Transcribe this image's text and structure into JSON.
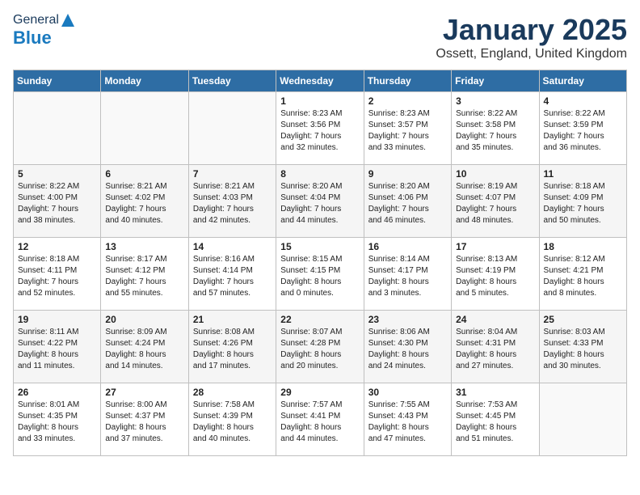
{
  "header": {
    "logo": {
      "general": "General",
      "blue": "Blue"
    },
    "title": "January 2025",
    "location": "Ossett, England, United Kingdom"
  },
  "weekdays": [
    "Sunday",
    "Monday",
    "Tuesday",
    "Wednesday",
    "Thursday",
    "Friday",
    "Saturday"
  ],
  "weeks": [
    [
      {
        "day": "",
        "text": ""
      },
      {
        "day": "",
        "text": ""
      },
      {
        "day": "",
        "text": ""
      },
      {
        "day": "1",
        "text": "Sunrise: 8:23 AM\nSunset: 3:56 PM\nDaylight: 7 hours\nand 32 minutes."
      },
      {
        "day": "2",
        "text": "Sunrise: 8:23 AM\nSunset: 3:57 PM\nDaylight: 7 hours\nand 33 minutes."
      },
      {
        "day": "3",
        "text": "Sunrise: 8:22 AM\nSunset: 3:58 PM\nDaylight: 7 hours\nand 35 minutes."
      },
      {
        "day": "4",
        "text": "Sunrise: 8:22 AM\nSunset: 3:59 PM\nDaylight: 7 hours\nand 36 minutes."
      }
    ],
    [
      {
        "day": "5",
        "text": "Sunrise: 8:22 AM\nSunset: 4:00 PM\nDaylight: 7 hours\nand 38 minutes."
      },
      {
        "day": "6",
        "text": "Sunrise: 8:21 AM\nSunset: 4:02 PM\nDaylight: 7 hours\nand 40 minutes."
      },
      {
        "day": "7",
        "text": "Sunrise: 8:21 AM\nSunset: 4:03 PM\nDaylight: 7 hours\nand 42 minutes."
      },
      {
        "day": "8",
        "text": "Sunrise: 8:20 AM\nSunset: 4:04 PM\nDaylight: 7 hours\nand 44 minutes."
      },
      {
        "day": "9",
        "text": "Sunrise: 8:20 AM\nSunset: 4:06 PM\nDaylight: 7 hours\nand 46 minutes."
      },
      {
        "day": "10",
        "text": "Sunrise: 8:19 AM\nSunset: 4:07 PM\nDaylight: 7 hours\nand 48 minutes."
      },
      {
        "day": "11",
        "text": "Sunrise: 8:18 AM\nSunset: 4:09 PM\nDaylight: 7 hours\nand 50 minutes."
      }
    ],
    [
      {
        "day": "12",
        "text": "Sunrise: 8:18 AM\nSunset: 4:11 PM\nDaylight: 7 hours\nand 52 minutes."
      },
      {
        "day": "13",
        "text": "Sunrise: 8:17 AM\nSunset: 4:12 PM\nDaylight: 7 hours\nand 55 minutes."
      },
      {
        "day": "14",
        "text": "Sunrise: 8:16 AM\nSunset: 4:14 PM\nDaylight: 7 hours\nand 57 minutes."
      },
      {
        "day": "15",
        "text": "Sunrise: 8:15 AM\nSunset: 4:15 PM\nDaylight: 8 hours\nand 0 minutes."
      },
      {
        "day": "16",
        "text": "Sunrise: 8:14 AM\nSunset: 4:17 PM\nDaylight: 8 hours\nand 3 minutes."
      },
      {
        "day": "17",
        "text": "Sunrise: 8:13 AM\nSunset: 4:19 PM\nDaylight: 8 hours\nand 5 minutes."
      },
      {
        "day": "18",
        "text": "Sunrise: 8:12 AM\nSunset: 4:21 PM\nDaylight: 8 hours\nand 8 minutes."
      }
    ],
    [
      {
        "day": "19",
        "text": "Sunrise: 8:11 AM\nSunset: 4:22 PM\nDaylight: 8 hours\nand 11 minutes."
      },
      {
        "day": "20",
        "text": "Sunrise: 8:09 AM\nSunset: 4:24 PM\nDaylight: 8 hours\nand 14 minutes."
      },
      {
        "day": "21",
        "text": "Sunrise: 8:08 AM\nSunset: 4:26 PM\nDaylight: 8 hours\nand 17 minutes."
      },
      {
        "day": "22",
        "text": "Sunrise: 8:07 AM\nSunset: 4:28 PM\nDaylight: 8 hours\nand 20 minutes."
      },
      {
        "day": "23",
        "text": "Sunrise: 8:06 AM\nSunset: 4:30 PM\nDaylight: 8 hours\nand 24 minutes."
      },
      {
        "day": "24",
        "text": "Sunrise: 8:04 AM\nSunset: 4:31 PM\nDaylight: 8 hours\nand 27 minutes."
      },
      {
        "day": "25",
        "text": "Sunrise: 8:03 AM\nSunset: 4:33 PM\nDaylight: 8 hours\nand 30 minutes."
      }
    ],
    [
      {
        "day": "26",
        "text": "Sunrise: 8:01 AM\nSunset: 4:35 PM\nDaylight: 8 hours\nand 33 minutes."
      },
      {
        "day": "27",
        "text": "Sunrise: 8:00 AM\nSunset: 4:37 PM\nDaylight: 8 hours\nand 37 minutes."
      },
      {
        "day": "28",
        "text": "Sunrise: 7:58 AM\nSunset: 4:39 PM\nDaylight: 8 hours\nand 40 minutes."
      },
      {
        "day": "29",
        "text": "Sunrise: 7:57 AM\nSunset: 4:41 PM\nDaylight: 8 hours\nand 44 minutes."
      },
      {
        "day": "30",
        "text": "Sunrise: 7:55 AM\nSunset: 4:43 PM\nDaylight: 8 hours\nand 47 minutes."
      },
      {
        "day": "31",
        "text": "Sunrise: 7:53 AM\nSunset: 4:45 PM\nDaylight: 8 hours\nand 51 minutes."
      },
      {
        "day": "",
        "text": ""
      }
    ]
  ]
}
